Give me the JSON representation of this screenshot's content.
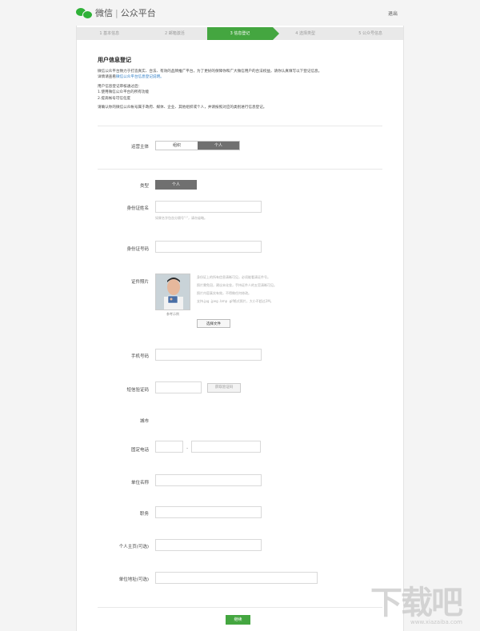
{
  "header": {
    "brand": "微信",
    "separator": "|",
    "subtitle": "公众平台",
    "logout": "退出"
  },
  "steps": [
    {
      "label": "1 基本信息"
    },
    {
      "label": "2 邮箱激活"
    },
    {
      "label": "3 信息登记"
    },
    {
      "label": "4 选择类型"
    },
    {
      "label": "5 公众号信息"
    }
  ],
  "intro": {
    "title": "用户信息登记",
    "p1": "微信公众平台致力于打造真实、合法、有效的品牌推广平台，为了更好的保障你和广大微信用户的合法权益，请你认真填写以下登记信息。",
    "p2_prefix": "详情请查看",
    "p2_link": "微信公众平台信息登记说明。",
    "p3": "用户信息登记审核通过后：",
    "p4": "1.使用微信公众平台的所有功能",
    "p5": "2.提高帐号可信任度",
    "p6": "请确认你的微信公众帐号属于政府、媒体、企业、其他组织或个人，并请按照对应的类别进行信息登记。"
  },
  "form": {
    "operator_label": "运营主体",
    "operator_options": [
      "组织",
      "个人"
    ],
    "type_label": "类型",
    "type_value": "个人",
    "id_name_label": "身份证姓名",
    "id_name_hint": "如果名字包含分隔号\"·\"，请勿省略。",
    "id_number_label": "身份证号码",
    "photo_label": "证件照片",
    "photo_caption": "参考示例",
    "photo_notes": [
      "身份证上的所有信息清晰可见，必须能看清证件号。",
      "照片需免冠，建议未化妆，手持证件人的五官清晰可见。",
      "照片内容真实有效，不得做任何修改。",
      "支持.jpg .jpeg .bmp .gif格式照片，大小不超过2M。"
    ],
    "choose_file": "选择文件",
    "phone_label": "手机号码",
    "sms_label": "短信验证码",
    "sms_button": "获取验证码",
    "city_label": "城市",
    "landline_label": "固定电话",
    "landline_sep": "-",
    "company_label": "单位名称",
    "position_label": "职务",
    "homepage_label": "个人主页(可选)",
    "address_label": "单位地址(可选)",
    "submit": "继续"
  },
  "watermark": {
    "text": "下载吧",
    "url": "www.xiazaiba.com"
  },
  "colors": {
    "accent": "#44a640",
    "selected_option": "#707070",
    "link": "#2c7bc4"
  }
}
